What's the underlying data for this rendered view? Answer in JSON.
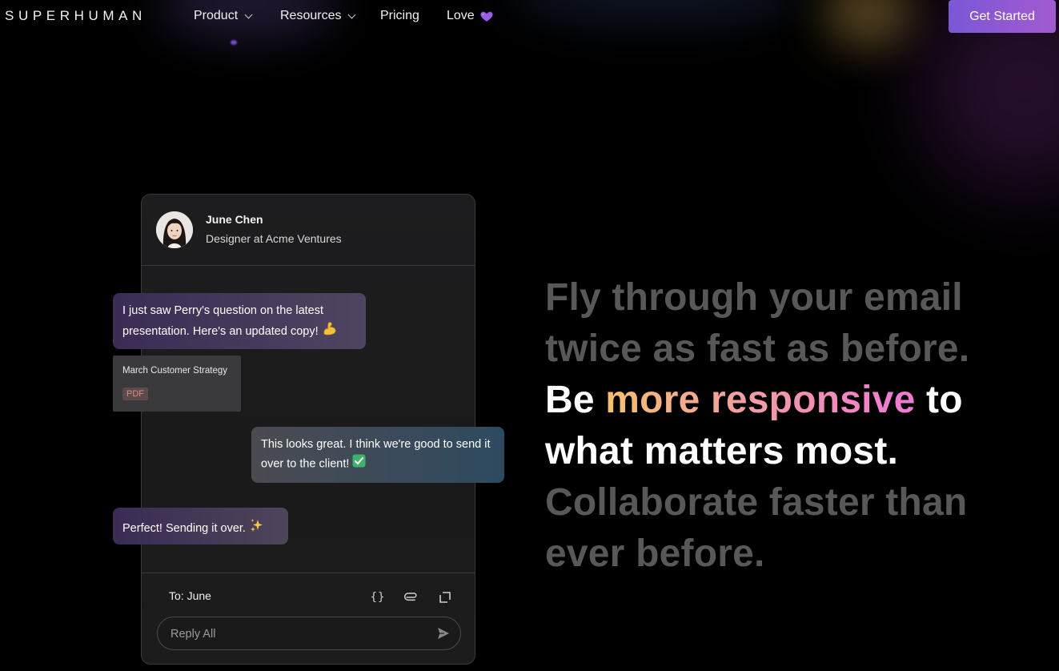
{
  "nav": {
    "logo": "SUPERHUMAN",
    "items": [
      {
        "label": "Product",
        "has_dropdown": true
      },
      {
        "label": "Resources",
        "has_dropdown": true
      },
      {
        "label": "Pricing",
        "has_dropdown": false
      },
      {
        "label": "Love",
        "has_dropdown": false,
        "icon": "purple-heart-icon"
      }
    ],
    "cta": "Get Started",
    "cta_color": "#8a58d4"
  },
  "card": {
    "contact_name": "June Chen",
    "contact_role": "Designer at Acme Ventures",
    "messages": [
      {
        "text": "I just saw Perry's question on the latest presentation. Here's an updated copy!",
        "icon": "flexed-biceps-icon"
      },
      {
        "text": "This looks great. I think we're good to send it over to the client!",
        "icon": "check-mark-button-icon"
      },
      {
        "text": "Perfect! Sending it over.",
        "icon": "sparkles-icon"
      }
    ],
    "attachment": {
      "title": "March Customer Strategy",
      "type": "PDF"
    },
    "to_label": "To: June",
    "reply_placeholder": "Reply All",
    "toolbar_icons": [
      "braces-icon",
      "paperclip-icon",
      "expand-icon"
    ]
  },
  "headline": {
    "line1": "Fly through your email",
    "line2": "twice as fast as before.",
    "line3_pre": "Be ",
    "line3_highlight": "more responsive",
    "line3_post": " to",
    "line4": "what matters most.",
    "line5": "Collaborate faster than",
    "line6": "ever before."
  },
  "colors": {
    "background": "#000000",
    "muted_text": "#585858",
    "highlight_gradient": [
      "#f7c06b",
      "#f3a19b",
      "#f078d8"
    ]
  }
}
